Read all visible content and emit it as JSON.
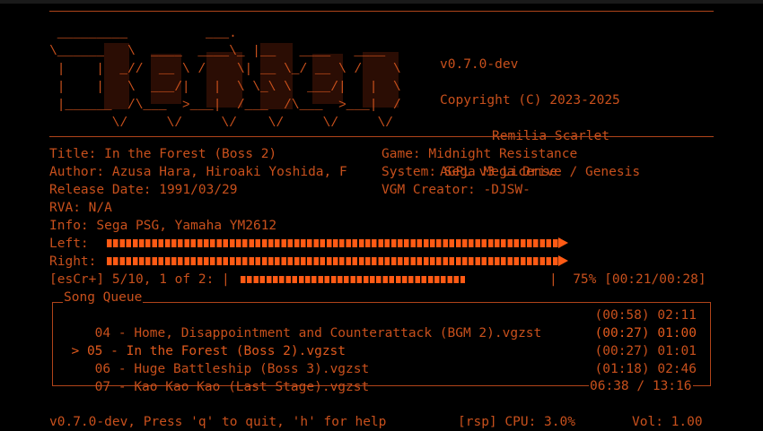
{
  "header": {
    "logo_art": " _________          ___.\n\\______   \\  ____  ____\\_ |__   ____   ____\n |    |  _//  __ \\ /    \\| __ \\_/ __ \\ /    \\\n |    |   \\  ___/|   |  \\ \\_\\ \\  ___/|   |  \\\n |______  /\\___  >___|  /___  /\\___  >___|  /\n        \\/     \\/     \\/    \\/     \\/     \\/",
    "version": "v0.7.0-dev",
    "copyright": "Copyright (C) 2023-2025",
    "author": "Remilia Scarlet",
    "license": "AGPL v3 License"
  },
  "track_info": {
    "title": "Title: In the Forest (Boss 2)",
    "author": "Author: Azusa Hara, Hiroaki Yoshida, F",
    "release_date": "Release Date: 1991/03/29",
    "rva": "RVA: N/A",
    "info": "Info: Sega PSG, Yamaha YM2612",
    "game": "Game: Midnight Resistance",
    "system": "System: Sega Mega Drive / Genesis",
    "vgm_creator": "VGM Creator: -DJSW-"
  },
  "meters": {
    "left_label": "Left:",
    "right_label": "Right:",
    "left_level": 0.68,
    "right_level": 0.68
  },
  "playback": {
    "status_prefix": "[esCr+] 5/10, 1 of 2: |",
    "status_suffix": "|  75% [00:21/00:28]",
    "progress": 0.75
  },
  "queue": {
    "title": "Song Queue",
    "items": [
      {
        "marker": " ",
        "name": "04 - Home, Disappointment and Counterattack (BGM 2).vgzst",
        "times": "(00:58) 02:11"
      },
      {
        "marker": ">",
        "name": "05 - In the Forest (Boss 2).vgzst",
        "times": "(00:27) 01:00"
      },
      {
        "marker": " ",
        "name": "06 - Huge Battleship (Boss 3).vgzst",
        "times": "(00:27) 01:01"
      },
      {
        "marker": " ",
        "name": "07 - Kao Kao Kao (Last Stage).vgzst",
        "times": "(01:18) 02:46"
      }
    ],
    "total": "06:38 / 13:16"
  },
  "footer": {
    "help": "v0.7.0-dev, Press 'q' to quit, 'h' for help",
    "cpu": "[rsp] CPU: 3.0%",
    "volume": "Vol: 1.00"
  },
  "colors": {
    "accent": "#c8501c",
    "meter": "#ff5a14",
    "background": "#000000"
  }
}
